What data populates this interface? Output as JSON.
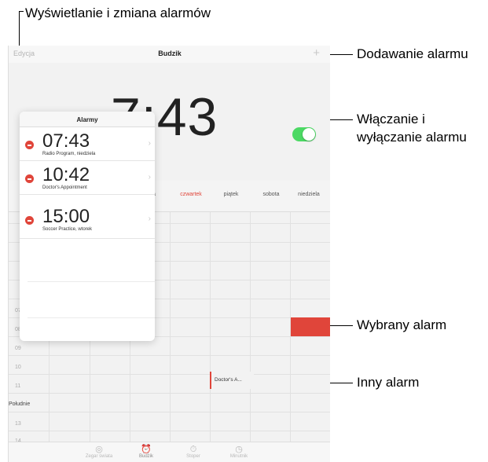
{
  "callouts": {
    "edit": "Wyświetlanie i zmiana alarmów",
    "add": "Dodawanie alarmu",
    "toggle_line1": "Włączanie i",
    "toggle_line2": "wyłączanie alarmu",
    "selected": "Wybrany alarm",
    "other": "Inny alarm"
  },
  "navbar": {
    "edit_label": "Edycja",
    "title": "Budzik",
    "add_icon": "+"
  },
  "hero": {
    "time": "7:43",
    "toggle_on": true,
    "toggle_color": "#4cd964"
  },
  "popover": {
    "title": "Alarmy",
    "alarms": [
      {
        "time": "07:43",
        "label": "Radio Program, niedziela"
      },
      {
        "time": "10:42",
        "label": "Doctor's Appointment"
      },
      {
        "time": "15:00",
        "label": "Soccer Practice, wtorek"
      }
    ],
    "delete_color": "#e0453a"
  },
  "days": [
    "oda",
    "czwartek",
    "piątek",
    "sobota",
    "niedziela"
  ],
  "hours": [
    "07",
    "08",
    "09",
    "10",
    "11",
    "Południe",
    "13",
    "14"
  ],
  "events": {
    "other": "Doctor's A...",
    "accent": "#e0453a"
  },
  "tabbar": {
    "tabs": [
      {
        "label": "Zegar świata",
        "icon": "globe-icon"
      },
      {
        "label": "Budzik",
        "icon": "alarm-clock-icon"
      },
      {
        "label": "Stoper",
        "icon": "stopwatch-icon"
      },
      {
        "label": "Minutnik",
        "icon": "timer-icon"
      }
    ]
  }
}
